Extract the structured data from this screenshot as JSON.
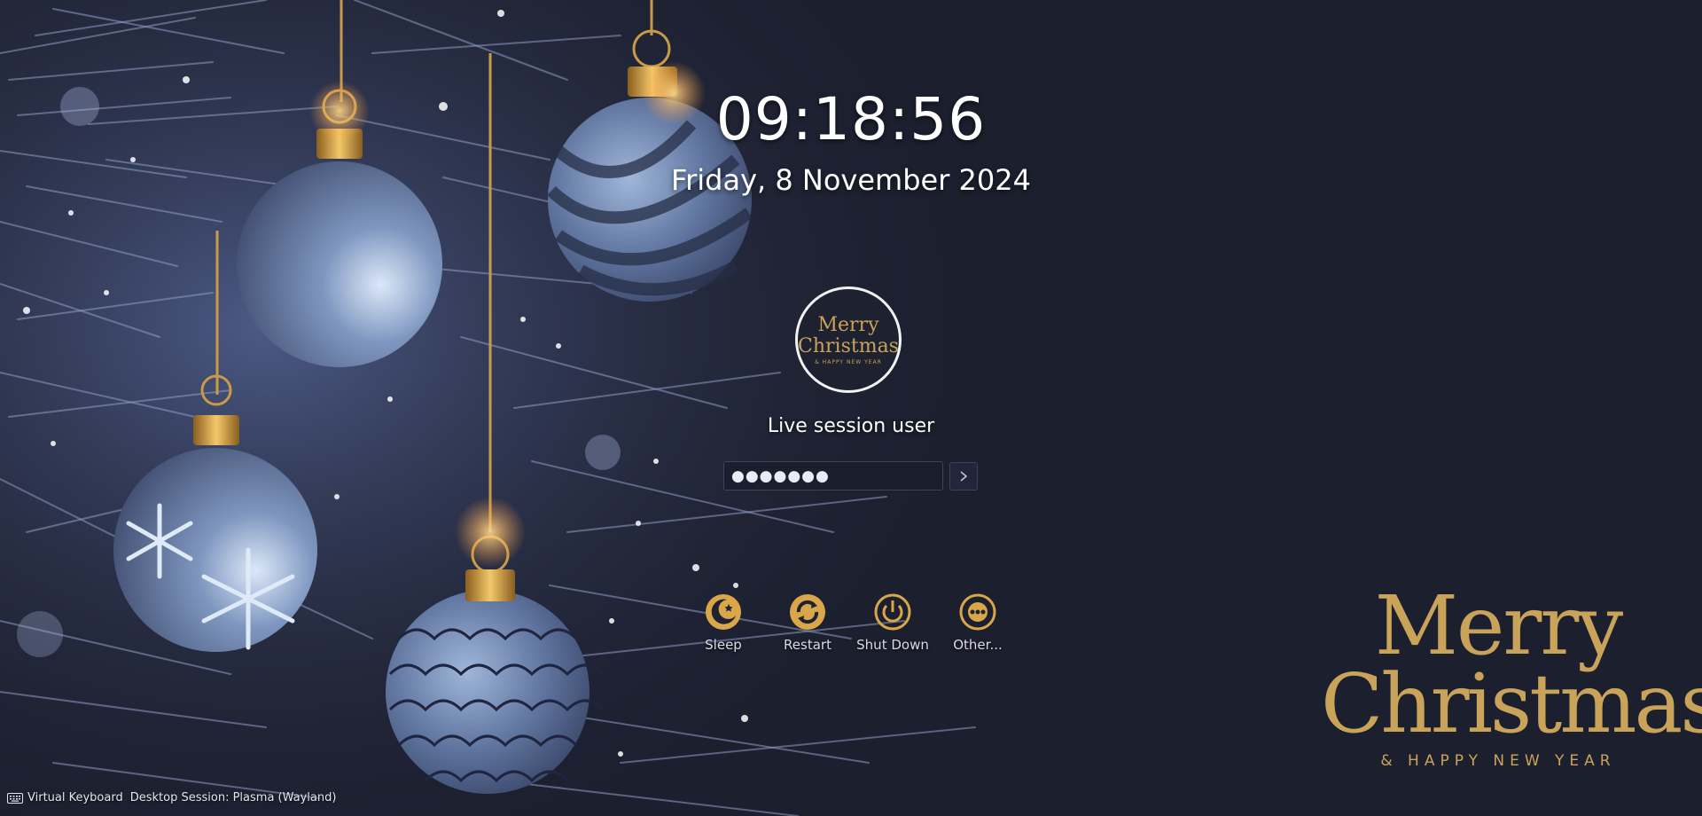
{
  "lockscreen": {
    "time": "09:18:56",
    "date": "Friday, 8 November 2024",
    "user": {
      "name": "Live session user",
      "avatar_line1": "Merry",
      "avatar_line2": "Christmas",
      "avatar_line3": "& HAPPY NEW YEAR"
    },
    "password": {
      "masked_value": "●●●●●●●"
    },
    "submit_icon": "chevron-right-icon"
  },
  "power_actions": [
    {
      "label": "Sleep",
      "icon": "sleep-moon-icon"
    },
    {
      "label": "Restart",
      "icon": "restart-icon"
    },
    {
      "label": "Shut Down",
      "icon": "power-icon"
    },
    {
      "label": "Other...",
      "icon": "more-icon"
    }
  ],
  "wallpaper_greeting": {
    "line1": "Merry",
    "line2": "Christmas",
    "line3": "& HAPPY NEW YEAR"
  },
  "bottom_bar": {
    "virtual_keyboard": "Virtual Keyboard",
    "session": "Desktop Session: Plasma (Wayland)"
  },
  "colors": {
    "background": "#1c1f2e",
    "gold": "#c9a35a",
    "ornament_blue": "#7b8fb8"
  }
}
